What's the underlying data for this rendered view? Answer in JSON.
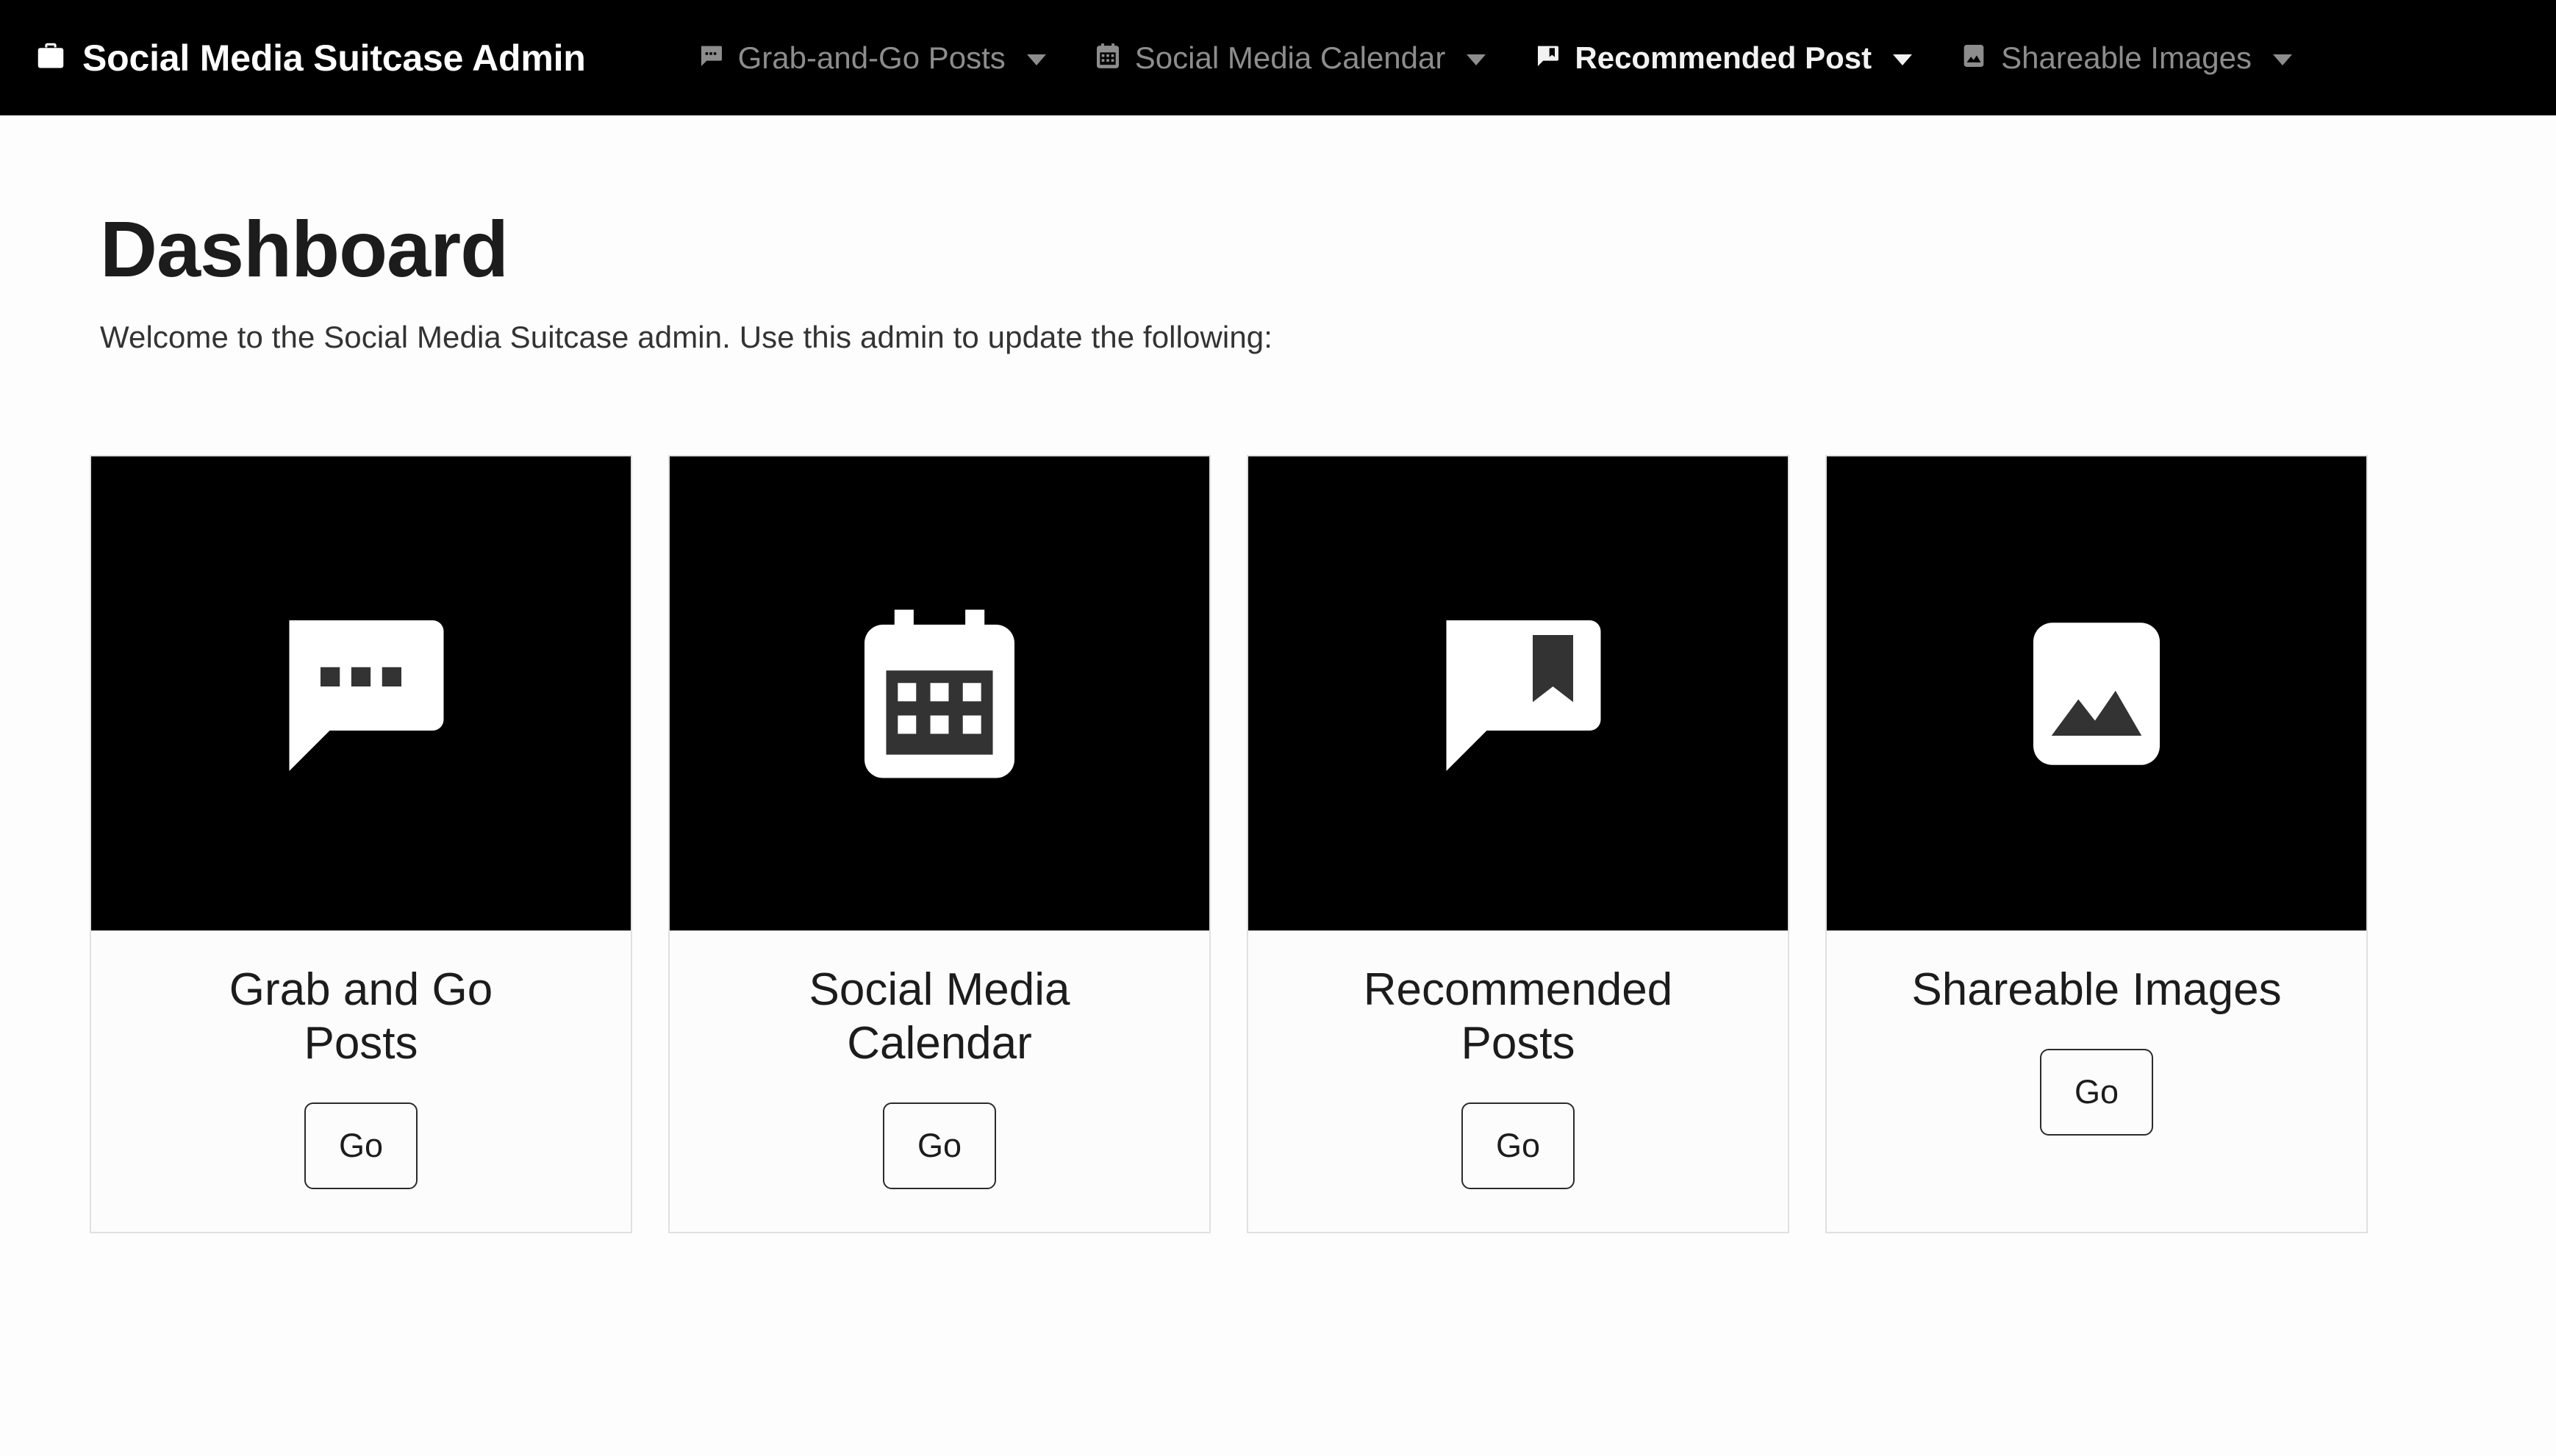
{
  "navbar": {
    "brand": {
      "label": "Social Media Suitcase Admin",
      "icon": "suitcase-icon"
    },
    "items": [
      {
        "label": "Grab-and-Go Posts",
        "icon": "speech-bubble-dots-icon",
        "has_caret": true,
        "active": false
      },
      {
        "label": "Social Media Calendar",
        "icon": "calendar-icon",
        "has_caret": true,
        "active": false
      },
      {
        "label": "Recommended Post",
        "icon": "speech-bubble-bookmark-icon",
        "has_caret": true,
        "active": true
      },
      {
        "label": "Shareable Images",
        "icon": "image-icon",
        "has_caret": true,
        "active": false
      }
    ]
  },
  "main": {
    "title": "Dashboard",
    "welcome": "Welcome to the Social Media Suitcase admin. Use this admin to update the following:",
    "cards": [
      {
        "title": "Grab and Go Posts",
        "icon": "speech-bubble-dots-icon",
        "button": "Go"
      },
      {
        "title": "Social Media Calendar",
        "icon": "calendar-icon",
        "button": "Go"
      },
      {
        "title": "Recommended Posts",
        "icon": "speech-bubble-bookmark-icon",
        "button": "Go"
      },
      {
        "title": "Shareable Images",
        "icon": "image-icon",
        "button": "Go"
      }
    ]
  },
  "colors": {
    "navbar_bg": "#000000",
    "page_bg": "#fdfdfd",
    "thumb_bg": "#000000",
    "icon_fill": "#ffffff",
    "icon_detail": "#333333",
    "nav_label": "#8d8d8d",
    "nav_label_active": "#f2f2f2",
    "card_border": "#e0e0e0",
    "text": "#1c1c1c"
  }
}
